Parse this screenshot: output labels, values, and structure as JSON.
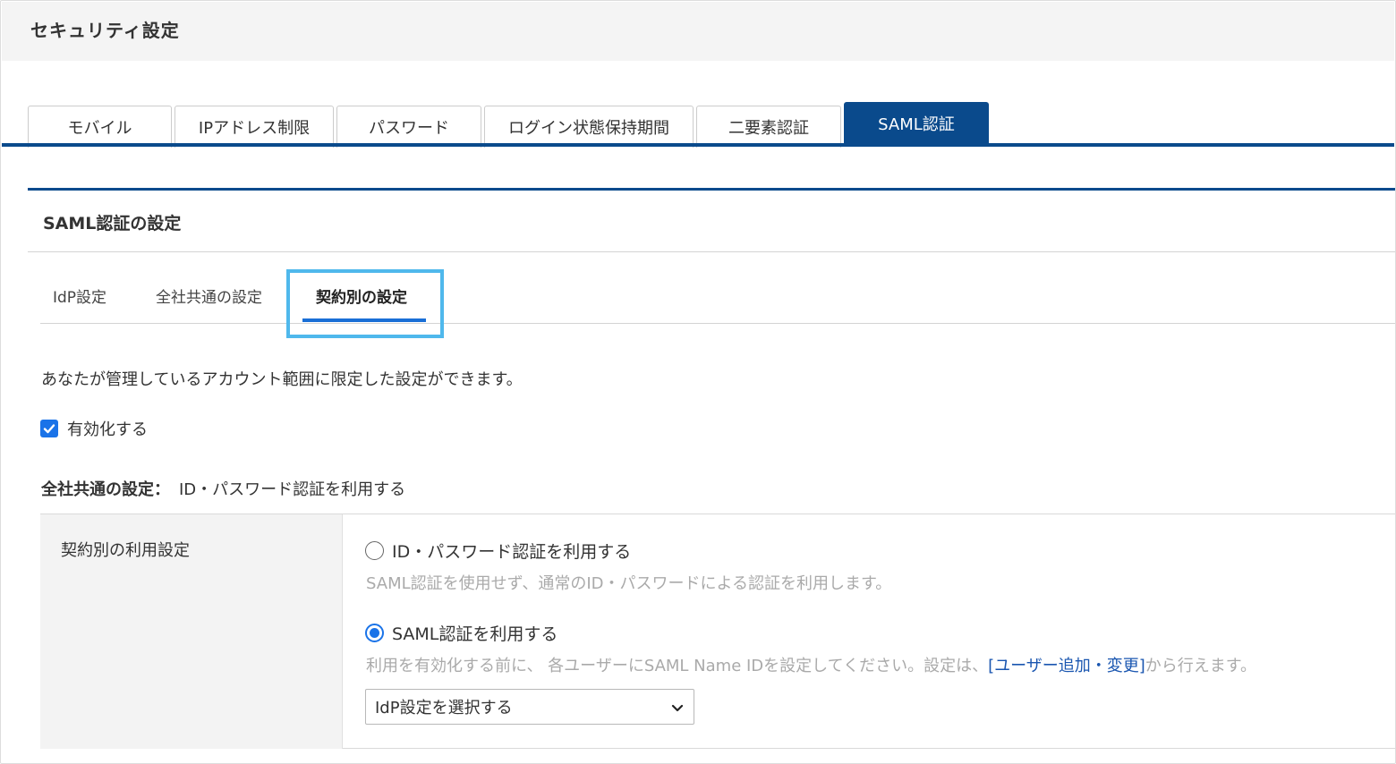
{
  "page": {
    "title": "セキュリティ設定"
  },
  "main_tabs": [
    {
      "label": "モバイル"
    },
    {
      "label": "IPアドレス制限"
    },
    {
      "label": "パスワード"
    },
    {
      "label": "ログイン状態保持期間"
    },
    {
      "label": "二要素認証"
    },
    {
      "label": "SAML認証",
      "active": true
    }
  ],
  "section": {
    "title": "SAML認証の設定"
  },
  "sub_tabs": [
    {
      "label": "IdP設定"
    },
    {
      "label": "全社共通の設定"
    },
    {
      "label": "契約別の設定",
      "active": true
    }
  ],
  "content": {
    "description": "あなたが管理しているアカウント範囲に限定した設定ができます。",
    "enable_checkbox": {
      "label": "有効化する",
      "checked": true
    },
    "common_setting": {
      "key": "全社共通の設定：",
      "value": "ID・パスワード認証を利用する"
    },
    "usage": {
      "label": "契約別の利用設定",
      "options": [
        {
          "label": "ID・パスワード認証を利用する",
          "help": "SAML認証を使用せず、通常のID・パスワードによる認証を利用します。",
          "checked": false
        },
        {
          "label": "SAML認証を利用する",
          "help_prefix": "利用を有効化する前に、 各ユーザーにSAML Name IDを設定してください。設定は、",
          "help_link": "[ユーザー追加・変更]",
          "help_suffix": "から行えます。",
          "checked": true
        }
      ],
      "select": {
        "value": "IdP設定を選択する"
      }
    }
  },
  "colors": {
    "primary": "#0a4a8c",
    "accent": "#1a73e8",
    "highlight": "#4fb8ec",
    "link": "#1a56b0",
    "muted_text": "#aaaaaa"
  }
}
